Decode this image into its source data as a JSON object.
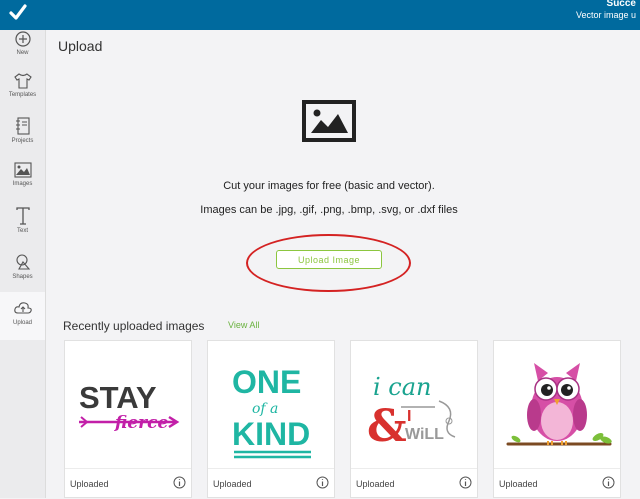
{
  "toast": {
    "title": "Succe",
    "message": "Vector image u"
  },
  "sidebar": {
    "items": [
      {
        "label": "New",
        "icon": "plus-circle-icon"
      },
      {
        "label": "Templates",
        "icon": "tshirt-icon"
      },
      {
        "label": "Projects",
        "icon": "notebook-icon"
      },
      {
        "label": "Images",
        "icon": "image-icon"
      },
      {
        "label": "Text",
        "icon": "text-icon"
      },
      {
        "label": "Shapes",
        "icon": "shapes-icon"
      },
      {
        "label": "Upload",
        "icon": "cloud-upload-icon"
      }
    ],
    "active": "Upload"
  },
  "main": {
    "title": "Upload",
    "line1": "Cut your images for free (basic and vector).",
    "line2": "Images can be .jpg, .gif, .png, .bmp, .svg, or .dxf files",
    "upload_button": "Upload Image"
  },
  "recent": {
    "title": "Recently uploaded images",
    "view_all": "View All",
    "cards": [
      {
        "status": "Uploaded",
        "art_text": [
          "STAY",
          "fierce"
        ]
      },
      {
        "status": "Uploaded",
        "art_text": [
          "ONE",
          "of a",
          "KIND"
        ]
      },
      {
        "status": "Uploaded",
        "art_text": [
          "i can",
          "&",
          "I",
          "WiLL"
        ]
      },
      {
        "status": "Uploaded",
        "art_text": []
      }
    ]
  },
  "colors": {
    "topbar": "#006a9e",
    "accent_green": "#8cc63f",
    "annotation_red": "#d42222"
  }
}
